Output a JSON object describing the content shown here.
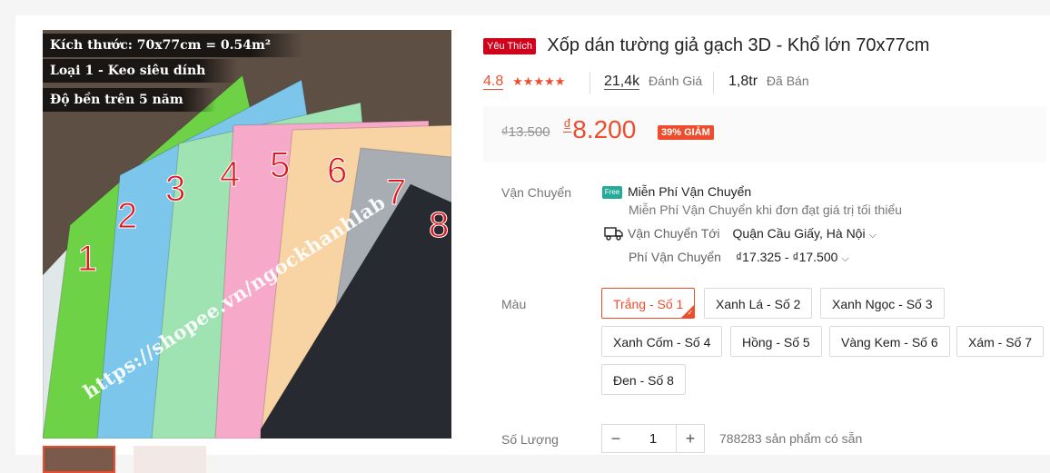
{
  "gallery": {
    "overlay_lines": [
      "Kích thước: 70x77cm = 0.54m²",
      "Loại 1 - Keo siêu dính",
      "Độ bền trên 5 năm"
    ],
    "panel_numbers": [
      "1",
      "2",
      "3",
      "4",
      "5",
      "6",
      "7",
      "8"
    ],
    "panel_colors": [
      "#dfe7e8",
      "#6ed247",
      "#7cc6ec",
      "#9fe3b2",
      "#f6a9c9",
      "#f8d3a4",
      "#a8adb4",
      "#272b31"
    ],
    "watermark": "https://shopee.vn/ngockhanhlab"
  },
  "product": {
    "favorite_badge": "Yêu Thích",
    "title": "Xốp dán tường giả gạch 3D - Khổ lớn 70x77cm",
    "rating": "4.8",
    "stars": "★★★★★",
    "review_count": "21,4k",
    "review_label": "Đánh Giá",
    "sold_count": "1,8tr",
    "sold_label": "Đã Bán"
  },
  "price": {
    "old": "₫13.500",
    "currency": "₫",
    "new": "8.200",
    "discount": "39% GIẢM"
  },
  "shipping": {
    "label": "Vận Chuyển",
    "free_icon": "Free",
    "free_title": "Miễn Phí Vận Chuyển",
    "free_subtitle": "Miễn Phí Vận Chuyển khi đơn đạt giá trị tối thiểu",
    "to_label": "Vận Chuyển Tới",
    "to_value": "Quận Cầu Giấy, Hà Nội",
    "fee_label": "Phí Vận Chuyển",
    "fee_value": "₫17.325 - ₫17.500"
  },
  "variants": {
    "label": "Màu",
    "options": [
      "Trắng - Số 1",
      "Xanh Lá - Số 2",
      "Xanh Ngọc - Số 3",
      "Xanh Cốm - Số 4",
      "Hồng - Số 5",
      "Vàng Kem - Số 6",
      "Xám - Số 7",
      "Đen - Số 8"
    ],
    "selected": "Trắng - Số 1"
  },
  "quantity": {
    "label": "Số Lượng",
    "value": "1",
    "minus": "−",
    "plus": "+",
    "stock_text": "788283 sản phẩm có sẵn"
  },
  "colors": {
    "accent": "#ee4d2d",
    "badge_red": "#d0011b",
    "free_green": "#26aa99"
  }
}
